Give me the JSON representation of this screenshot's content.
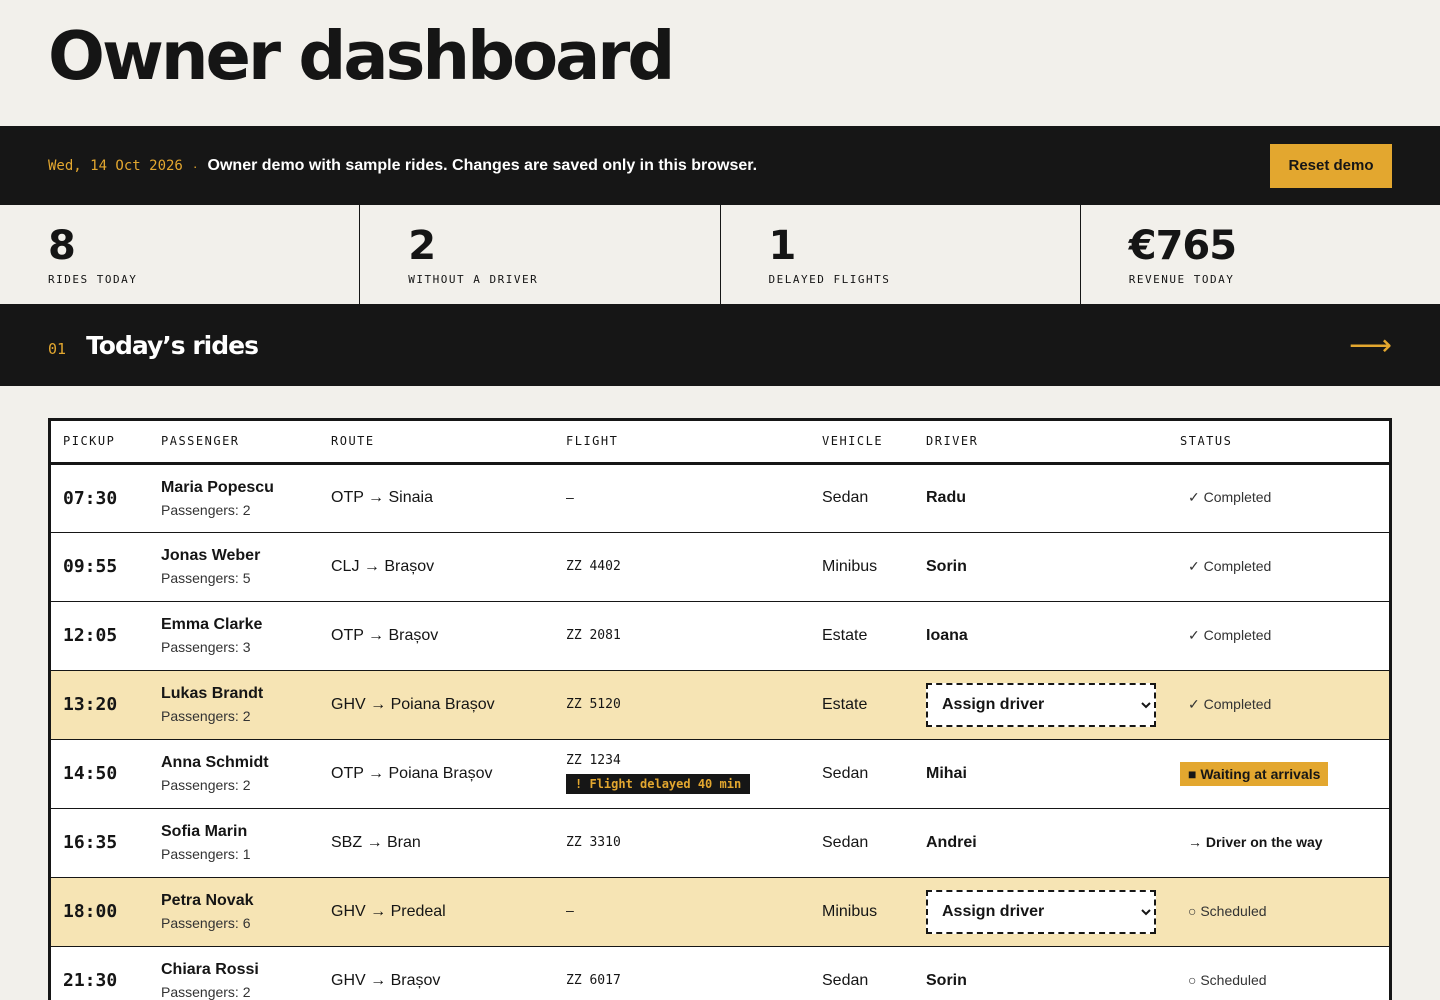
{
  "page": {
    "title": "Owner dashboard"
  },
  "notice": {
    "date": "Wed, 14 Oct 2026",
    "separator": "·",
    "text": "Owner demo with sample rides. Changes are saved only in this browser.",
    "reset_label": "Reset demo"
  },
  "stats": [
    {
      "value": "8",
      "label": "RIDES TODAY"
    },
    {
      "value": "2",
      "label": "WITHOUT A DRIVER"
    },
    {
      "value": "1",
      "label": "DELAYED FLIGHTS"
    },
    {
      "value": "€765",
      "label": "REVENUE TODAY"
    }
  ],
  "section": {
    "number": "01",
    "title": "Today’s rides",
    "arrow": "⟶"
  },
  "table": {
    "columns": [
      "PICKUP",
      "PASSENGER",
      "ROUTE",
      "FLIGHT",
      "VEHICLE",
      "DRIVER",
      "STATUS"
    ],
    "assign_placeholder": "Assign driver",
    "rows": [
      {
        "time": "07:30",
        "name": "Maria Popescu",
        "passengers": "Passengers: 2",
        "route": "OTP → Sinaia",
        "flight": "–",
        "delay": "",
        "vehicle": "Sedan",
        "driver": "Radu",
        "status": "✓ Completed",
        "status_style": "plain"
      },
      {
        "time": "09:55",
        "name": "Jonas Weber",
        "passengers": "Passengers: 5",
        "route": "CLJ → Brașov",
        "flight": "ZZ 4402",
        "delay": "",
        "vehicle": "Minibus",
        "driver": "Sorin",
        "status": "✓ Completed",
        "status_style": "plain"
      },
      {
        "time": "12:05",
        "name": "Emma Clarke",
        "passengers": "Passengers: 3",
        "route": "OTP → Brașov",
        "flight": "ZZ 2081",
        "delay": "",
        "vehicle": "Estate",
        "driver": "Ioana",
        "status": "✓ Completed",
        "status_style": "plain"
      },
      {
        "time": "13:20",
        "name": "Lukas Brandt",
        "passengers": "Passengers: 2",
        "route": "GHV → Poiana Brașov",
        "flight": "ZZ 5120",
        "delay": "",
        "vehicle": "Estate",
        "driver": "",
        "status": "✓ Completed",
        "status_style": "plain"
      },
      {
        "time": "14:50",
        "name": "Anna Schmidt",
        "passengers": "Passengers: 2",
        "route": "OTP → Poiana Brașov",
        "flight": "ZZ 1234",
        "delay": "! Flight delayed 40 min",
        "vehicle": "Sedan",
        "driver": "Mihai",
        "status": "■ Waiting at arrivals",
        "status_style": "badge"
      },
      {
        "time": "16:35",
        "name": "Sofia Marin",
        "passengers": "Passengers: 1",
        "route": "SBZ → Bran",
        "flight": "ZZ 3310",
        "delay": "",
        "vehicle": "Sedan",
        "driver": "Andrei",
        "status": "→ Driver on the way",
        "status_style": "bold"
      },
      {
        "time": "18:00",
        "name": "Petra Novak",
        "passengers": "Passengers: 6",
        "route": "GHV → Predeal",
        "flight": "–",
        "delay": "",
        "vehicle": "Minibus",
        "driver": "",
        "status": "○ Scheduled",
        "status_style": "plain"
      },
      {
        "time": "21:30",
        "name": "Chiara Rossi",
        "passengers": "Passengers: 2",
        "route": "GHV → Brașov",
        "flight": "ZZ 6017",
        "delay": "",
        "vehicle": "Sedan",
        "driver": "Sorin",
        "status": "○ Scheduled",
        "status_style": "plain"
      }
    ]
  },
  "colors": {
    "accent": "#e3a72f",
    "dark": "#161616",
    "background": "#f2f0eb",
    "highlight_row": "#f6e4b4"
  }
}
